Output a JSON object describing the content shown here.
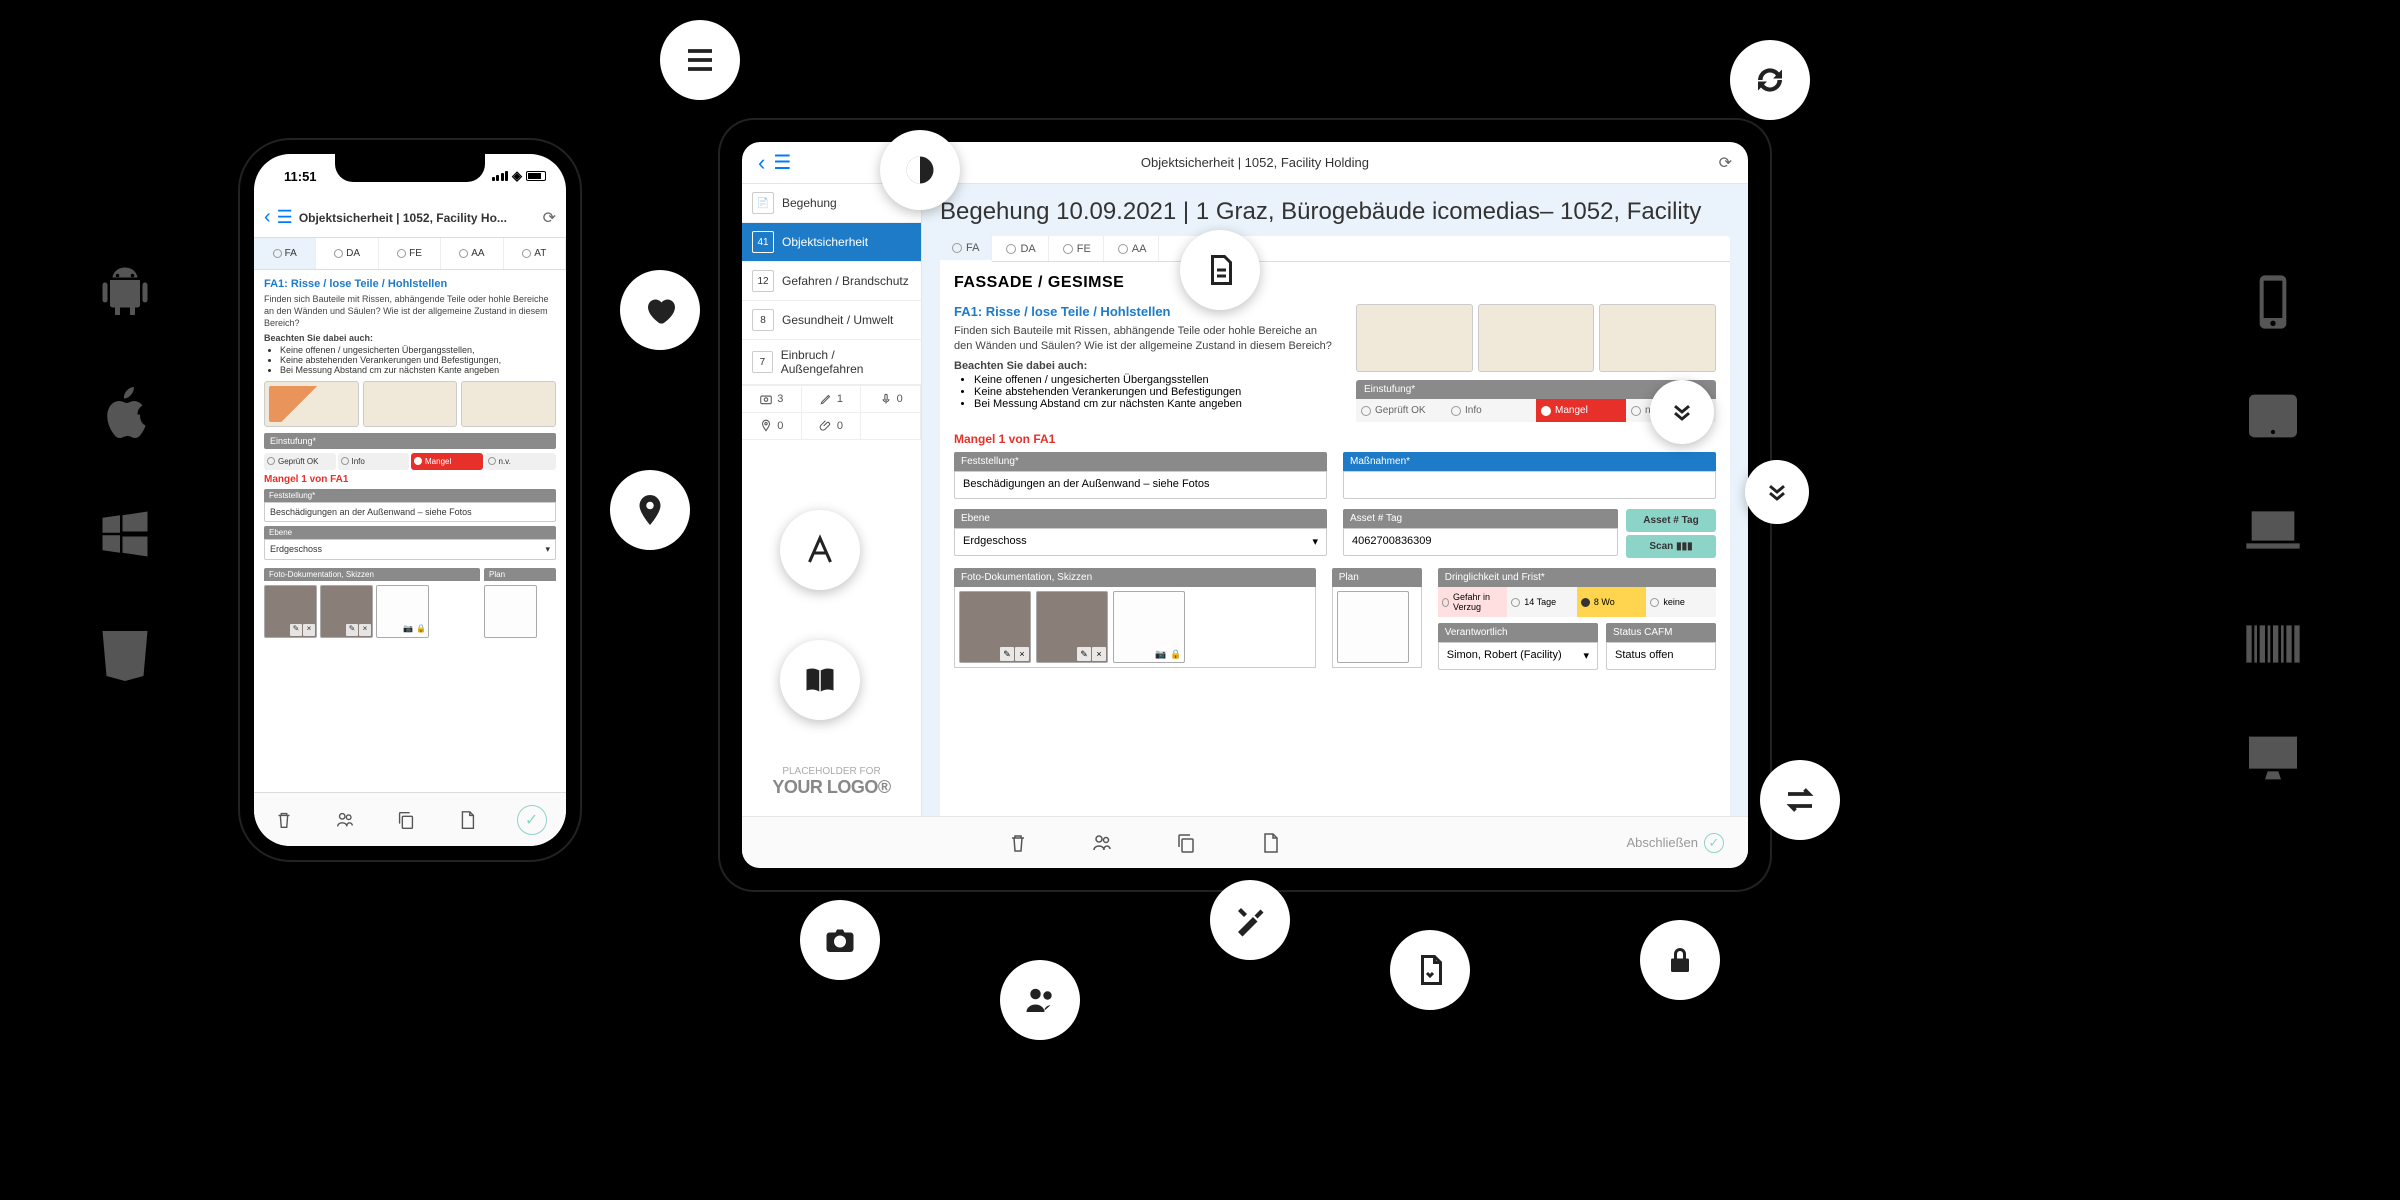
{
  "platforms": [
    "android",
    "apple",
    "windows",
    "html5"
  ],
  "devices": [
    "phone-device",
    "tablet-device",
    "laptop-device",
    "barcode",
    "desktop-device"
  ],
  "phone": {
    "time": "11:51",
    "header_title": "Objektsicherheit | 1052, Facility Ho...",
    "tabs": [
      "FA",
      "DA",
      "FE",
      "AA",
      "AT"
    ],
    "fa_title": "FA1: Risse / lose Teile / Hohlstellen",
    "fa_desc": "Finden sich Bauteile mit Rissen, abhängende Teile oder hohle Bereiche an den Wänden und Säulen? Wie ist der allgemeine Zustand in diesem Bereich?",
    "beachten": "Beachten Sie dabei auch:",
    "bullets": [
      "Keine offenen / ungesicherten Übergangsstellen,",
      "Keine abstehenden Verankerungen und Befestigungen,",
      "Bei Messung Abstand cm zur nächsten Kante angeben"
    ],
    "einstufung_label": "Einstufung*",
    "einstufung_opts": [
      "Geprüft OK",
      "Info",
      "Mangel",
      "n.v."
    ],
    "mangel_hdr": "Mangel 1 von FA1",
    "feststellung_label": "Feststellung*",
    "feststellung_value": "Beschädigungen an der Außenwand – siehe Fotos",
    "ebene_label": "Ebene",
    "ebene_value": "Erdgeschoss",
    "photo_label": "Foto-Dokumentation, Skizzen",
    "plan_label": "Plan"
  },
  "tablet": {
    "header_title": "Objektsicherheit | 1052, Facility Holding",
    "sidebar": [
      {
        "label": "Begehung",
        "badge": ""
      },
      {
        "label": "Objektsicherheit",
        "badge": "41"
      },
      {
        "label": "Gefahren / Brandschutz",
        "badge": "12"
      },
      {
        "label": "Gesundheit / Umwelt",
        "badge": "8"
      },
      {
        "label": "Einbruch / Außengefahren",
        "badge": "7"
      }
    ],
    "stats": [
      {
        "icon": "camera",
        "val": "3"
      },
      {
        "icon": "pencil",
        "val": "1"
      },
      {
        "icon": "mic",
        "val": "0"
      },
      {
        "icon": "pin",
        "val": "0"
      },
      {
        "icon": "clip",
        "val": "0"
      },
      {
        "icon": "",
        "val": ""
      }
    ],
    "logo_placeholder": "PLACEHOLDER FOR",
    "logo_text": "YOUR LOGO®",
    "beg_label": "Begehung",
    "beg_date": "10.09.2021 | 1 Graz, Bürogebäude icomedias– 1052, Facility",
    "ctabs": [
      "FA",
      "DA",
      "FE",
      "AA"
    ],
    "section": "FASSADE / GESIMSE",
    "fa_title": "FA1: Risse / lose Teile / Hohlstellen",
    "fa_desc": "Finden sich Bauteile mit Rissen, abhängende Teile oder hohle Bereiche an den Wänden und Säulen? Wie ist der allgemeine Zustand in diesem Bereich?",
    "beachten": "Beachten Sie dabei auch:",
    "bullets": [
      "Keine offenen / ungesicherten Übergangsstellen",
      "Keine abstehenden Verankerungen und Befestigungen",
      "Bei Messung Abstand cm zur nächsten Kante angeben"
    ],
    "einstufung_label": "Einstufung*",
    "einstufung_opts": [
      "Geprüft OK",
      "Info",
      "Mangel",
      "n.v."
    ],
    "mangel_hdr": "Mangel 1 von FA1",
    "feststellung_label": "Feststellung*",
    "feststellung_value": "Beschädigungen an der Außenwand – siehe Fotos",
    "massnahmen_label": "Maßnahmen*",
    "ebene_label": "Ebene",
    "ebene_value": "Erdgeschoss",
    "asset_label": "Asset # Tag",
    "asset_value": "4062700836309",
    "asset_btn1": "Asset # Tag",
    "asset_btn2": "Scan",
    "photo_label": "Foto-Dokumentation, Skizzen",
    "plan_label": "Plan",
    "dring_label": "Dringlichkeit und Frist*",
    "dring_opts": [
      "Gefahr in Verzug",
      "14 Tage",
      "8 Wo",
      "keine"
    ],
    "verant_label": "Verantwortlich",
    "verant_value": "Simon, Robert (Facility)",
    "status_label": "Status CAFM",
    "status_value": "Status offen",
    "close_btn": "Abschließen"
  }
}
